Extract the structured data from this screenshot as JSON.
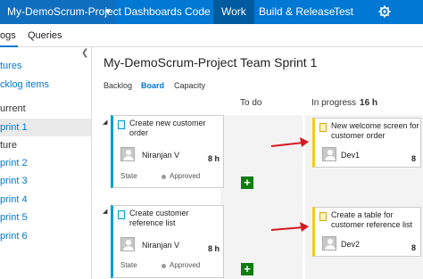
{
  "topbar": {
    "project": "My-DemoScrum-Project",
    "nav": [
      "Dashboards",
      "Code",
      "Work",
      "Build & Release",
      "Test"
    ]
  },
  "subnav": {
    "tabs": [
      "ogs",
      "Queries"
    ]
  },
  "sidebar": {
    "items": [
      {
        "label": "tures",
        "kind": "link"
      },
      {
        "label": "cklog items",
        "kind": "link"
      },
      {
        "label": "urrent",
        "kind": "head"
      },
      {
        "label": "print 1",
        "kind": "link",
        "selected": true
      },
      {
        "label": "ture",
        "kind": "head"
      },
      {
        "label": "print 2",
        "kind": "link"
      },
      {
        "label": "print 3",
        "kind": "link"
      },
      {
        "label": "print 4",
        "kind": "link"
      },
      {
        "label": "print 5",
        "kind": "link"
      },
      {
        "label": "print 6",
        "kind": "link"
      }
    ]
  },
  "main": {
    "title": "My-DemoScrum-Project Team Sprint 1",
    "view_tabs": [
      "Backlog",
      "Board",
      "Capacity"
    ],
    "columns": {
      "todo": {
        "name": "To do"
      },
      "in_progress": {
        "name": "In progress",
        "hours": "16 h"
      }
    },
    "pbi_cards": [
      {
        "title": "Create new customer order",
        "assignee": "Niranjan V",
        "hours": "8 h",
        "state_label": "State",
        "state": "Approved"
      },
      {
        "title": "Create customer reference list",
        "assignee": "Niranjan V",
        "hours": "8 h",
        "state_label": "State",
        "state": "Approved"
      }
    ],
    "task_cards": [
      {
        "title": "New welcome screen for customer order",
        "assignee": "Dev1",
        "hours": "8"
      },
      {
        "title": "Create a table for customer reference list",
        "assignee": "Dev2",
        "hours": "8"
      }
    ]
  },
  "colors": {
    "brand": "#0078d4",
    "pbi": "#009ccc",
    "task": "#f2cb1d",
    "add": "#107c10",
    "arrow": "#d71920"
  },
  "icons": [
    "chevron-down-icon",
    "gear-icon",
    "collapse-icon",
    "expand-icon",
    "pbi-icon",
    "task-icon",
    "avatar-icon",
    "add-icon",
    "arrow-icon"
  ]
}
